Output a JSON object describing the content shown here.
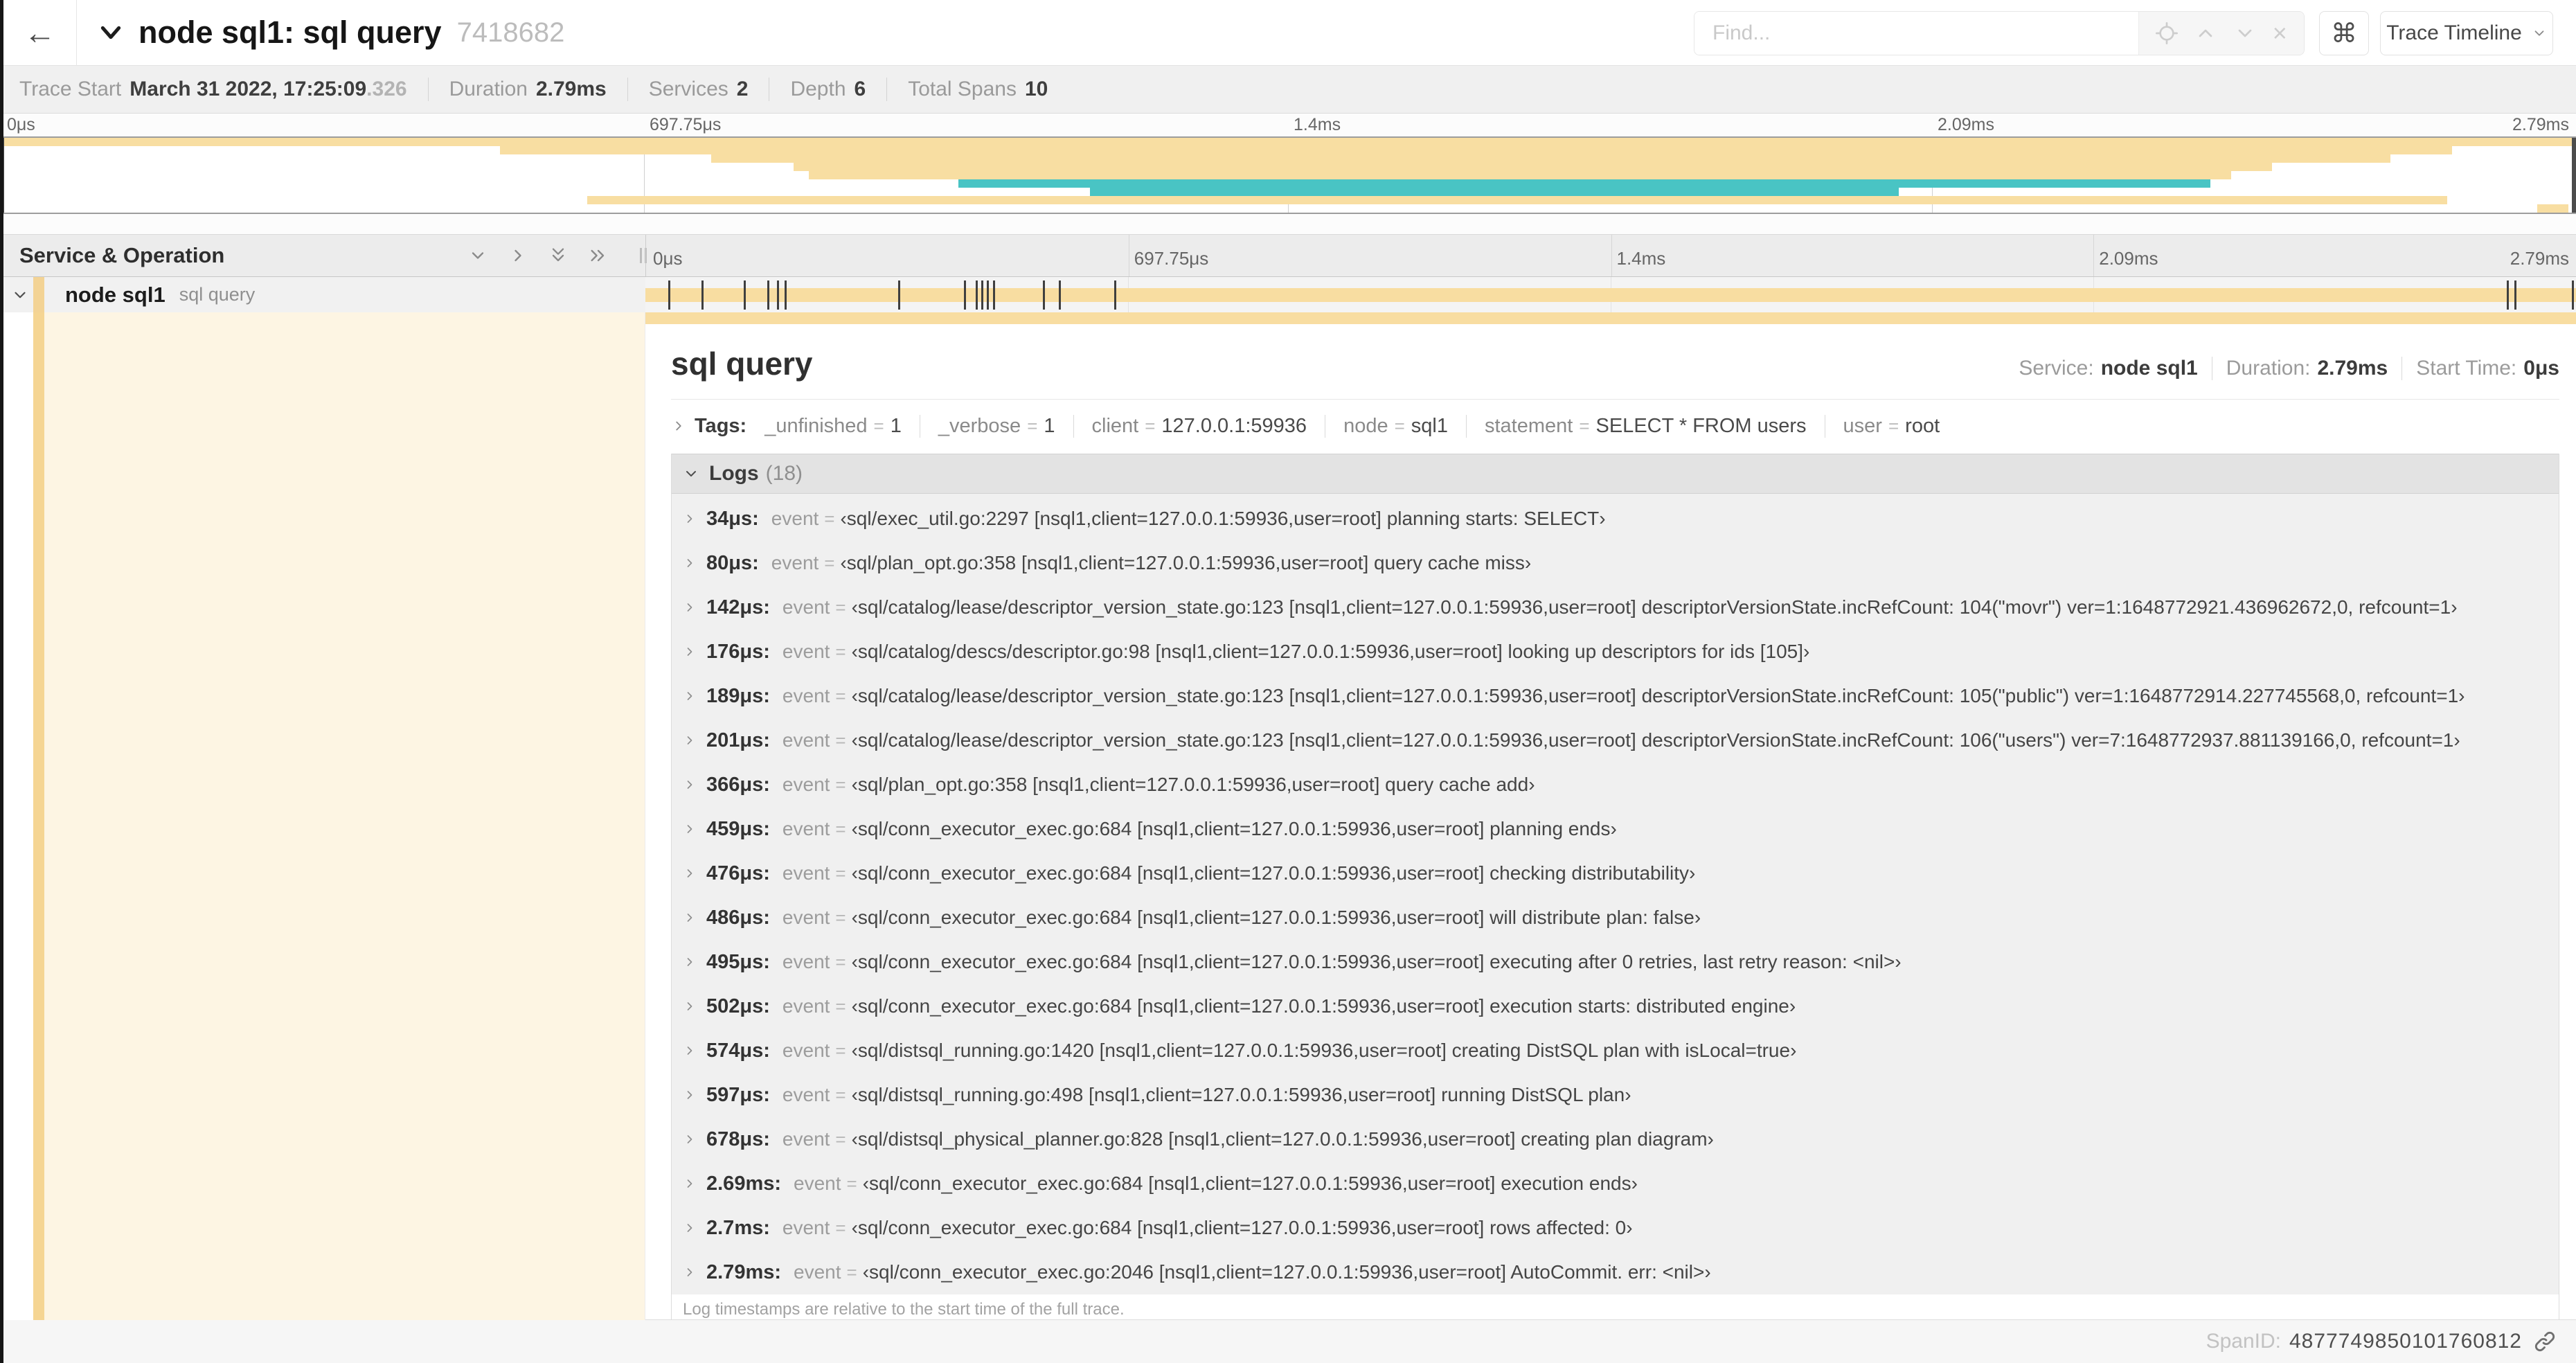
{
  "header": {
    "back": "←",
    "title": "node sql1: sql query",
    "trace_id": "7418682",
    "find": {
      "placeholder": "Find...",
      "clear": "×"
    },
    "shortcut": "⌘",
    "view_button": "Trace Timeline"
  },
  "meta": {
    "items": [
      {
        "label": "Trace Start",
        "value": "March 31 2022, 17:25:09",
        "suffix": ".326"
      },
      {
        "label": "Duration",
        "value": "2.79ms",
        "suffix": ""
      },
      {
        "label": "Services",
        "value": "2",
        "suffix": ""
      },
      {
        "label": "Depth",
        "value": "6",
        "suffix": ""
      },
      {
        "label": "Total Spans",
        "value": "10",
        "suffix": ""
      }
    ]
  },
  "minimap": {
    "colors": {
      "tan": "#F8DEA2",
      "teal": "#49C4C4"
    },
    "bars": [
      {
        "start_pct": 0,
        "end_pct": 100,
        "color": "tan"
      },
      {
        "start_pct": 19.4,
        "end_pct": 95.2,
        "color": "tan"
      },
      {
        "start_pct": 27.6,
        "end_pct": 92.8,
        "color": "tan"
      },
      {
        "start_pct": 30.8,
        "end_pct": 88.2,
        "color": "tan"
      },
      {
        "start_pct": 31.4,
        "end_pct": 86.6,
        "color": "tan"
      },
      {
        "start_pct": 37.2,
        "end_pct": 85.8,
        "color": "teal"
      },
      {
        "start_pct": 42.3,
        "end_pct": 73.7,
        "color": "teal"
      },
      {
        "start_pct": 22.8,
        "end_pct": 95.0,
        "color": "tan"
      },
      {
        "start_pct": 98.5,
        "end_pct": 99.7,
        "color": "tan"
      }
    ]
  },
  "timeline": {
    "left_header": "Service & Operation",
    "ticks": [
      "0μs",
      "697.75μs",
      "1.4ms",
      "2.09ms",
      "2.79ms"
    ],
    "row": {
      "service": "node sql1",
      "operation": "sql query"
    },
    "bar_color": "#F8DDA1",
    "span_bar_ticks_pct": [
      1.2,
      2.9,
      5.1,
      6.3,
      6.8,
      7.2,
      13.1,
      16.5,
      17.1,
      17.4,
      17.7,
      18.0,
      20.6,
      21.4,
      24.3,
      96.4,
      96.8,
      99.8
    ]
  },
  "detail": {
    "title": "sql query",
    "meta": [
      {
        "label": "Service:",
        "value": "node sql1"
      },
      {
        "label": "Duration:",
        "value": "2.79ms"
      },
      {
        "label": "Start Time:",
        "value": "0μs"
      }
    ],
    "tags": {
      "label": "Tags:",
      "eq": "=",
      "items": [
        {
          "key": "_unfinished",
          "value": "1"
        },
        {
          "key": "_verbose",
          "value": "1"
        },
        {
          "key": "client",
          "value": "127.0.0.1:59936"
        },
        {
          "key": "node",
          "value": "sql1"
        },
        {
          "key": "statement",
          "value": "SELECT * FROM users"
        },
        {
          "key": "user",
          "value": "root"
        }
      ]
    },
    "logs": {
      "label": "Logs",
      "count": "(18)",
      "key": "event",
      "eq": "=",
      "entries": [
        {
          "time": "34μs:",
          "value": "‹sql/exec_util.go:2297 [nsql1,client=127.0.0.1:59936,user=root] planning starts: SELECT›"
        },
        {
          "time": "80μs:",
          "value": "‹sql/plan_opt.go:358 [nsql1,client=127.0.0.1:59936,user=root] query cache miss›"
        },
        {
          "time": "142μs:",
          "value": "‹sql/catalog/lease/descriptor_version_state.go:123 [nsql1,client=127.0.0.1:59936,user=root] descriptorVersionState.incRefCount: 104(\"movr\") ver=1:1648772921.436962672,0, refcount=1›"
        },
        {
          "time": "176μs:",
          "value": "‹sql/catalog/descs/descriptor.go:98 [nsql1,client=127.0.0.1:59936,user=root] looking up descriptors for ids [105]›"
        },
        {
          "time": "189μs:",
          "value": "‹sql/catalog/lease/descriptor_version_state.go:123 [nsql1,client=127.0.0.1:59936,user=root] descriptorVersionState.incRefCount: 105(\"public\") ver=1:1648772914.227745568,0, refcount=1›"
        },
        {
          "time": "201μs:",
          "value": "‹sql/catalog/lease/descriptor_version_state.go:123 [nsql1,client=127.0.0.1:59936,user=root] descriptorVersionState.incRefCount: 106(\"users\") ver=7:1648772937.881139166,0, refcount=1›"
        },
        {
          "time": "366μs:",
          "value": "‹sql/plan_opt.go:358 [nsql1,client=127.0.0.1:59936,user=root] query cache add›"
        },
        {
          "time": "459μs:",
          "value": "‹sql/conn_executor_exec.go:684 [nsql1,client=127.0.0.1:59936,user=root] planning ends›"
        },
        {
          "time": "476μs:",
          "value": "‹sql/conn_executor_exec.go:684 [nsql1,client=127.0.0.1:59936,user=root] checking distributability›"
        },
        {
          "time": "486μs:",
          "value": "‹sql/conn_executor_exec.go:684 [nsql1,client=127.0.0.1:59936,user=root] will distribute plan: false›"
        },
        {
          "time": "495μs:",
          "value": "‹sql/conn_executor_exec.go:684 [nsql1,client=127.0.0.1:59936,user=root] executing after 0 retries, last retry reason: <nil>›"
        },
        {
          "time": "502μs:",
          "value": "‹sql/conn_executor_exec.go:684 [nsql1,client=127.0.0.1:59936,user=root] execution starts: distributed engine›"
        },
        {
          "time": "574μs:",
          "value": "‹sql/distsql_running.go:1420 [nsql1,client=127.0.0.1:59936,user=root] creating DistSQL plan with isLocal=true›"
        },
        {
          "time": "597μs:",
          "value": "‹sql/distsql_running.go:498 [nsql1,client=127.0.0.1:59936,user=root] running DistSQL plan›"
        },
        {
          "time": "678μs:",
          "value": "‹sql/distsql_physical_planner.go:828 [nsql1,client=127.0.0.1:59936,user=root] creating plan diagram›"
        },
        {
          "time": "2.69ms:",
          "value": "‹sql/conn_executor_exec.go:684 [nsql1,client=127.0.0.1:59936,user=root] execution ends›"
        },
        {
          "time": "2.7ms:",
          "value": "‹sql/conn_executor_exec.go:684 [nsql1,client=127.0.0.1:59936,user=root] rows affected: 0›"
        },
        {
          "time": "2.79ms:",
          "value": "‹sql/conn_executor_exec.go:2046 [nsql1,client=127.0.0.1:59936,user=root] AutoCommit. err: <nil>›"
        }
      ],
      "note": "Log timestamps are relative to the start time of the full trace."
    },
    "footer": {
      "label": "SpanID:",
      "value": "4877749850101760812"
    }
  }
}
